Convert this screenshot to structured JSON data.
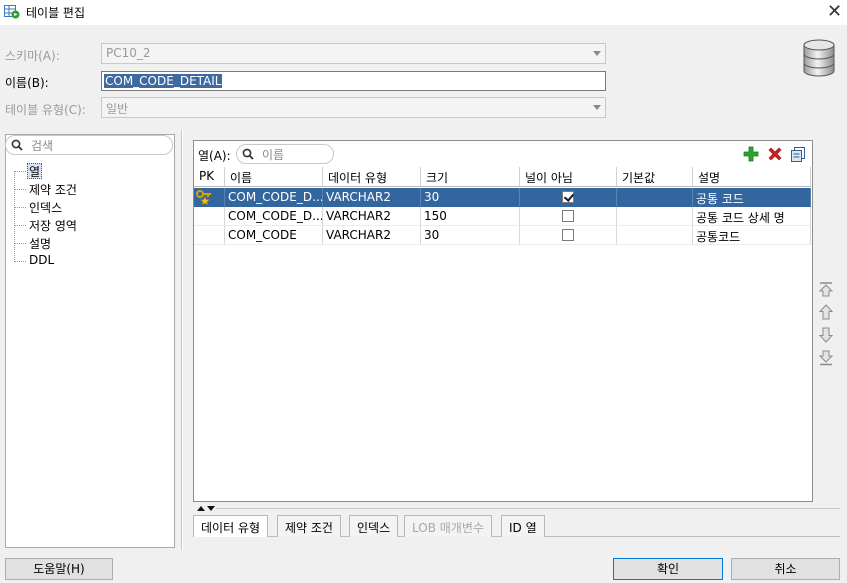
{
  "window": {
    "title": "테이블 편집",
    "close_glyph": "✕"
  },
  "form": {
    "schema_label": "스키마(A):",
    "schema_value": "PC10_2",
    "name_label": "이름(B):",
    "name_value": "COM_CODE_DETAIL",
    "table_type_label": "테이블 유형(C):",
    "table_type_value": "일반"
  },
  "nav": {
    "search_placeholder": "검색",
    "items": [
      "열",
      "제약 조건",
      "인덱스",
      "저장 영역",
      "설명",
      "DDL"
    ],
    "selected_index": 0
  },
  "columns_panel": {
    "label": "열(A):",
    "search_placeholder": "이름",
    "headers": [
      "PK",
      "이름",
      "데이터 유형",
      "크기",
      "널이 아님",
      "기본값",
      "설명"
    ],
    "rows": [
      {
        "pk": true,
        "name": "COM_CODE_D...",
        "type": "VARCHAR2",
        "size": "30",
        "not_null": true,
        "default": "",
        "comment": "공통 코드"
      },
      {
        "pk": false,
        "name": "COM_CODE_D...",
        "type": "VARCHAR2",
        "size": "150",
        "not_null": false,
        "default": "",
        "comment": "공통 코드 상세 명"
      },
      {
        "pk": false,
        "name": "COM_CODE",
        "type": "VARCHAR2",
        "size": "30",
        "not_null": false,
        "default": "",
        "comment": "공통코드"
      }
    ],
    "selected_row": 0
  },
  "bottom_tabs": [
    "데이터 유형",
    "제약 조건",
    "인덱스",
    "LOB 매개변수",
    "ID 열"
  ],
  "footer": {
    "help_label": "도움말(H)",
    "ok_label": "확인",
    "cancel_label": "취소"
  },
  "colors": {
    "selection": "#33669f",
    "add_icon": "#2ea12e",
    "delete_icon": "#d02020"
  }
}
